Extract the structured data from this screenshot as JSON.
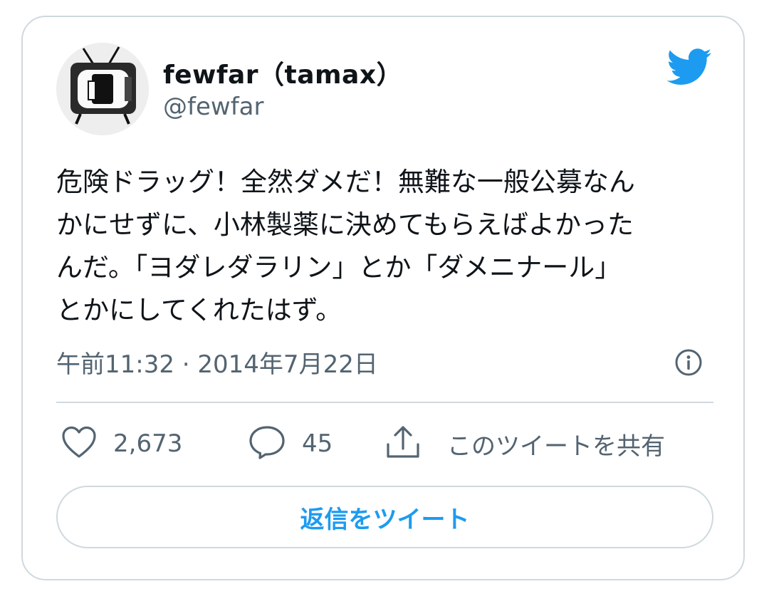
{
  "user": {
    "display_name": "fewfar（tamax）",
    "handle": "@fewfar"
  },
  "tweet": {
    "text": "危険ドラッグ！全然ダメだ！無難な一般公募なん\nかにせずに、小林製薬に決めてもらえばよかった\nんだ。「ヨダレダラリン」とか「ダメニナール」\nとかにしてくれたはず。",
    "timestamp": "午前11:32 · 2014年7月22日"
  },
  "actions": {
    "like_count": "2,673",
    "reply_count": "45",
    "share_label": "このツイートを共有"
  },
  "reply_button_label": "返信をツイート",
  "colors": {
    "brand": "#1d9bf0",
    "text": "#0f1419",
    "secondary_text": "#536471",
    "border": "#cfd9de"
  },
  "icons": {
    "brand": "twitter-bird-icon",
    "info": "info-icon",
    "like": "heart-icon",
    "reply": "reply-bubble-icon",
    "share": "share-icon"
  }
}
